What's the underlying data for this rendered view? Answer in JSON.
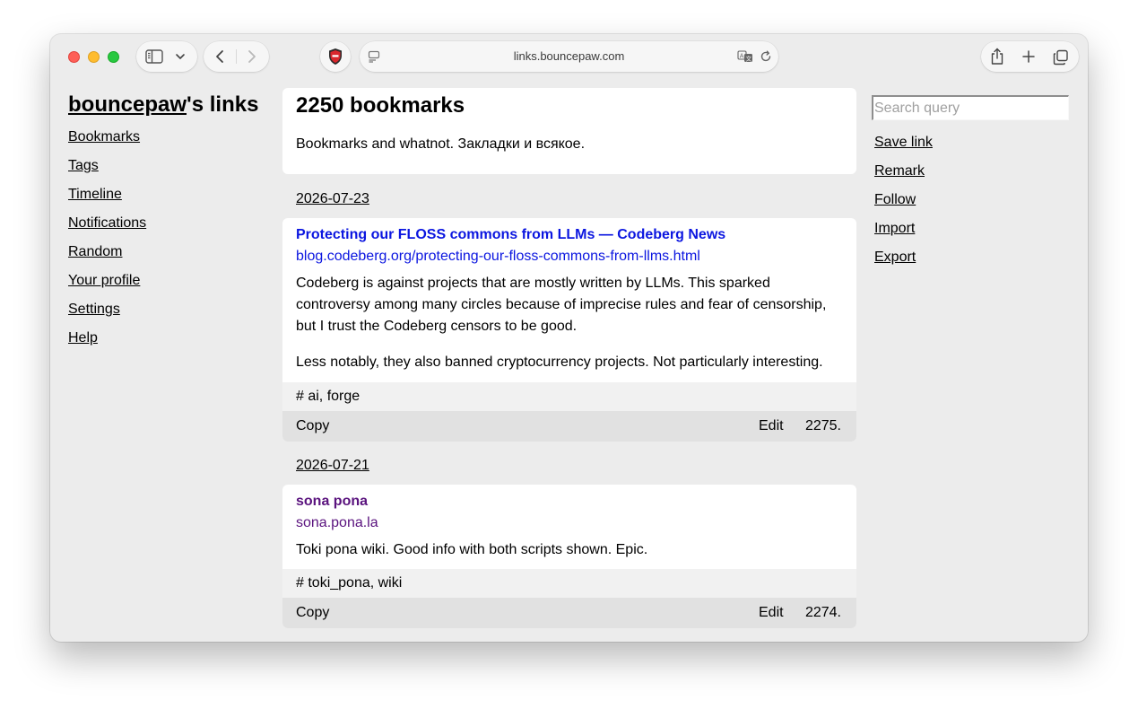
{
  "browser": {
    "address": "links.bouncepaw.com"
  },
  "sidebar": {
    "title_link": "bouncepaw",
    "title_suffix": "'s links",
    "items": [
      {
        "label": "Bookmarks"
      },
      {
        "label": "Tags"
      },
      {
        "label": "Timeline"
      },
      {
        "label": "Notifications"
      },
      {
        "label": "Random"
      },
      {
        "label": "Your profile"
      },
      {
        "label": "Settings"
      },
      {
        "label": "Help"
      }
    ]
  },
  "main": {
    "heading": "2250 bookmarks",
    "description": "Bookmarks and whatnot. Закладки и всякое.",
    "posts": [
      {
        "date": "2026-07-23",
        "title": "Protecting our FLOSS commons from LLMs — Codeberg News",
        "url": "blog.codeberg.org/protecting-our-floss-commons-from-llms.html",
        "paragraphs": [
          "Codeberg is against projects that are mostly written by LLMs. This sparked controversy among many circles because of imprecise rules and fear of censorship, but I trust the Codeberg censors to be good.",
          "Less notably, they also banned cryptocurrency projects. Not particularly interesting."
        ],
        "tags": "# ai, forge",
        "copy": "Copy",
        "edit": "Edit",
        "number": "2275.",
        "link_color": "#0b16e0"
      },
      {
        "date": "2026-07-21",
        "title": "sona pona",
        "url": "sona.pona.la",
        "paragraphs": [
          "Toki pona wiki. Good info with both scripts shown. Epic."
        ],
        "tags": "# toki_pona, wiki",
        "copy": "Copy",
        "edit": "Edit",
        "number": "2274.",
        "link_color": "#5a137e"
      }
    ]
  },
  "right": {
    "search_placeholder": "Search query",
    "links": [
      {
        "label": "Save link"
      },
      {
        "label": "Remark"
      },
      {
        "label": "Follow"
      },
      {
        "label": "Import"
      },
      {
        "label": "Export"
      }
    ]
  }
}
